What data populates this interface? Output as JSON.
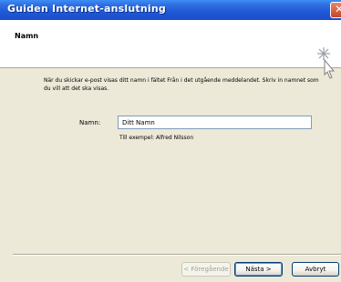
{
  "window": {
    "title": "Guiden Internet-anslutning",
    "close_icon": "close-icon",
    "close_glyph": "✕"
  },
  "header": {
    "title": "Namn",
    "icon": "wizard-icon"
  },
  "body": {
    "instructions": "När du skickar e-post visas ditt namn i fältet Från i det utgående meddelandet. Skriv in namnet som du vill att det ska visas.",
    "name_label": "Namn:",
    "name_value": "Ditt Namn",
    "example": "Till exempel: Alfred Nilsson"
  },
  "footer": {
    "back_label": "< Föregående",
    "next_label": "Nästa >",
    "cancel_label": "Avbryt"
  }
}
